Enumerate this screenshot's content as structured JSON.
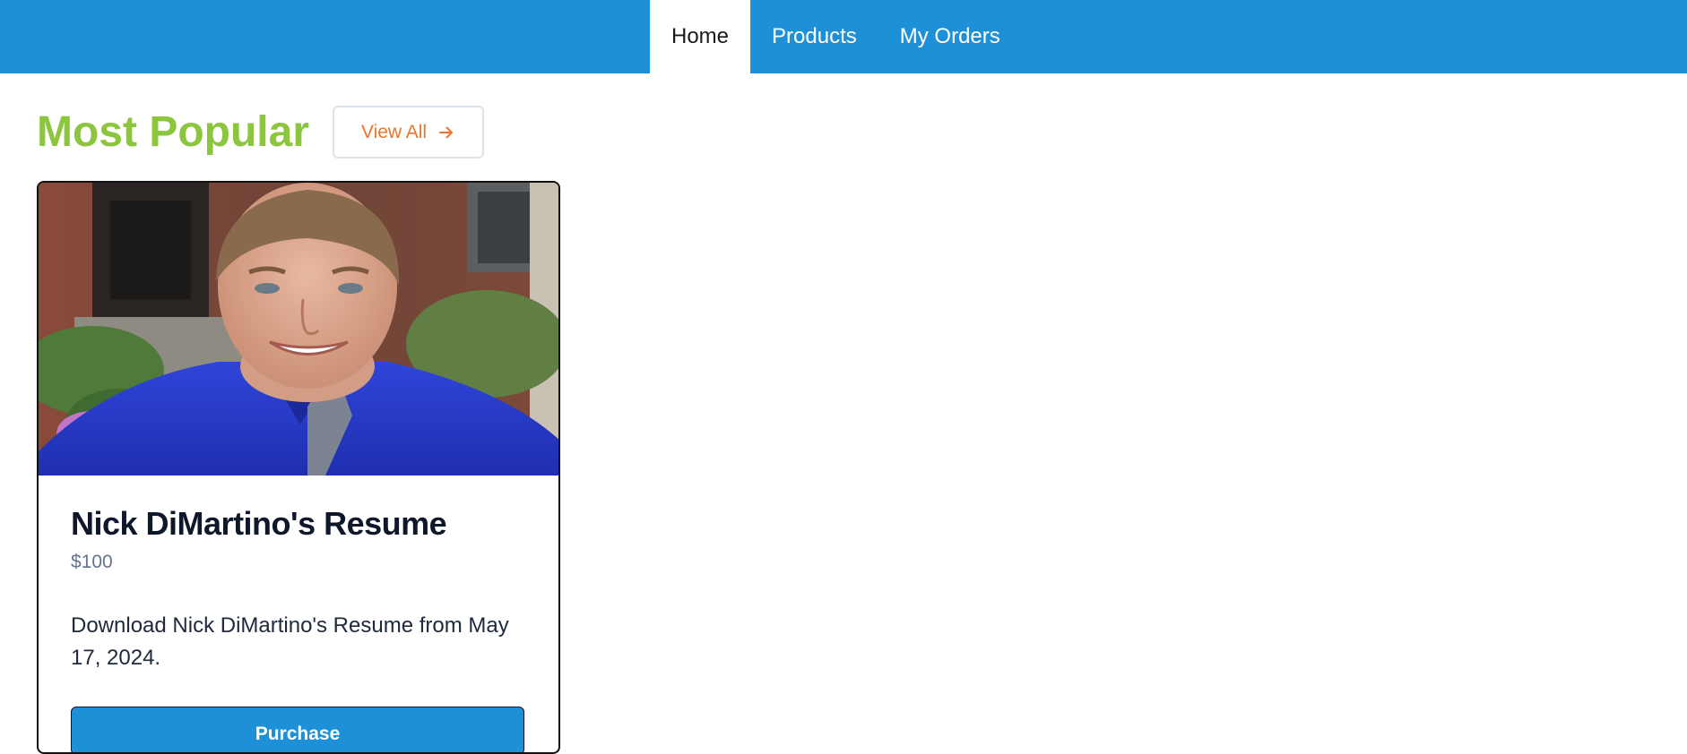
{
  "nav": {
    "items": [
      {
        "label": "Home",
        "active": true
      },
      {
        "label": "Products",
        "active": false
      },
      {
        "label": "My Orders",
        "active": false
      }
    ],
    "background_color": "#1e90d8"
  },
  "section": {
    "title": "Most Popular",
    "title_color": "#8cc63f",
    "view_all_label": "View All",
    "view_all_icon": "arrow-right-icon",
    "view_all_color": "#e8762c"
  },
  "product": {
    "title": "Nick DiMartino's Resume",
    "price": "$100",
    "description": "Download Nick DiMartino's Resume from May 17, 2024.",
    "purchase_label": "Purchase",
    "button_color": "#1e90d8"
  }
}
